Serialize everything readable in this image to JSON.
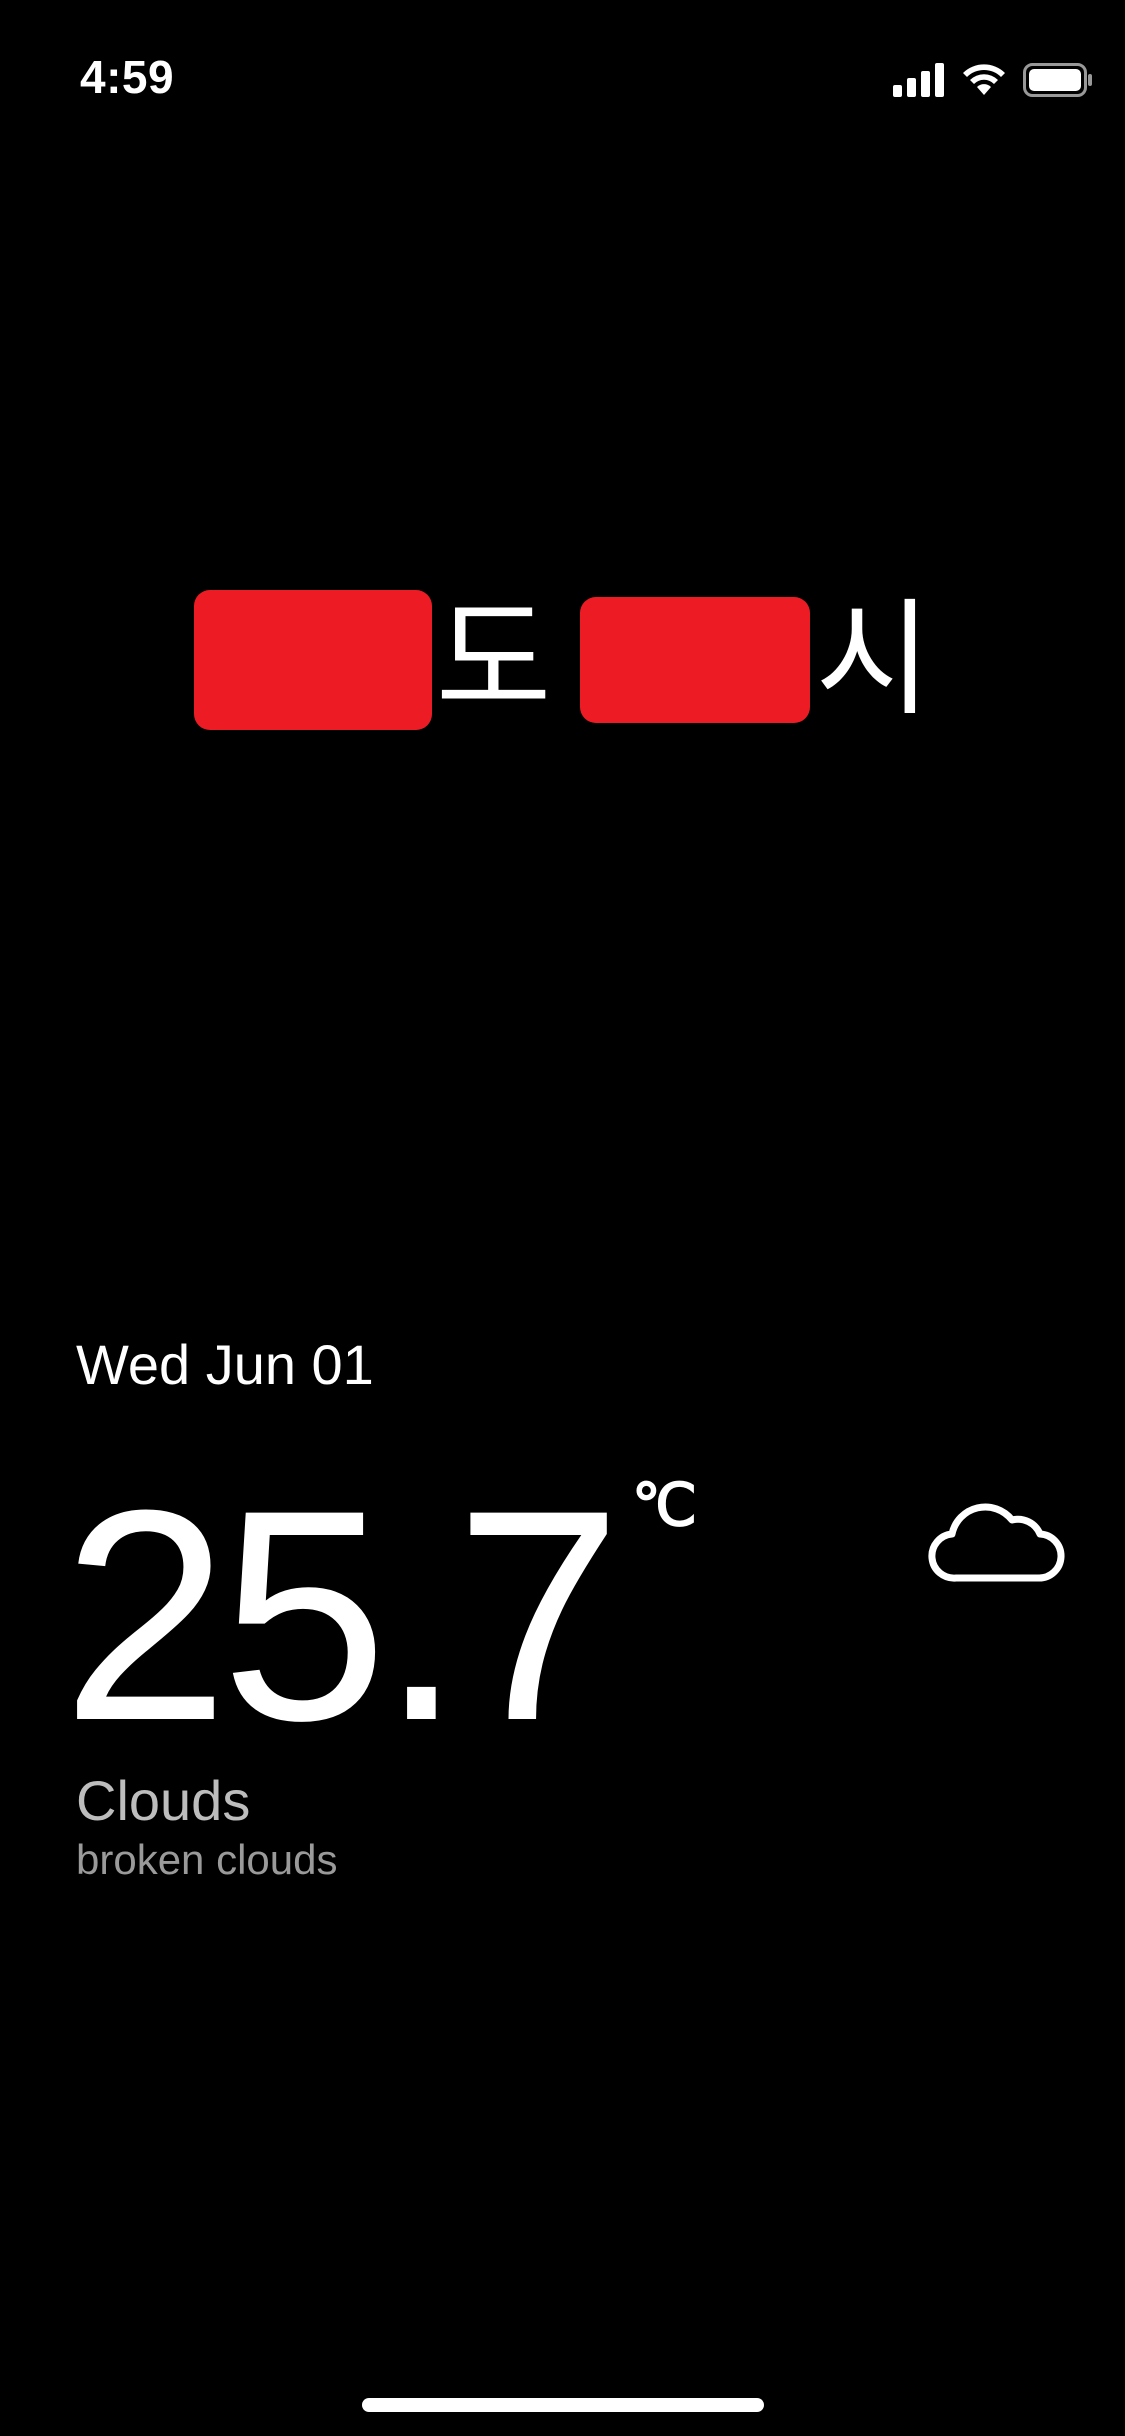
{
  "status_bar": {
    "time": "4:59",
    "icons": [
      "cellular-signal-icon",
      "wifi-icon",
      "battery-icon"
    ]
  },
  "location": {
    "province_suffix": "도",
    "city_suffix": "시",
    "redaction_color": "#ED1C24"
  },
  "weather": {
    "date": "Wed Jun 01",
    "temperature": "25.7",
    "unit": "℃",
    "main": "Clouds",
    "description": "broken clouds",
    "icon": "cloud-icon"
  },
  "colors": {
    "background": "#000000",
    "text": "#FFFFFF",
    "main_desc": "#BDBDBD",
    "sub_desc": "#9A9A9A"
  }
}
